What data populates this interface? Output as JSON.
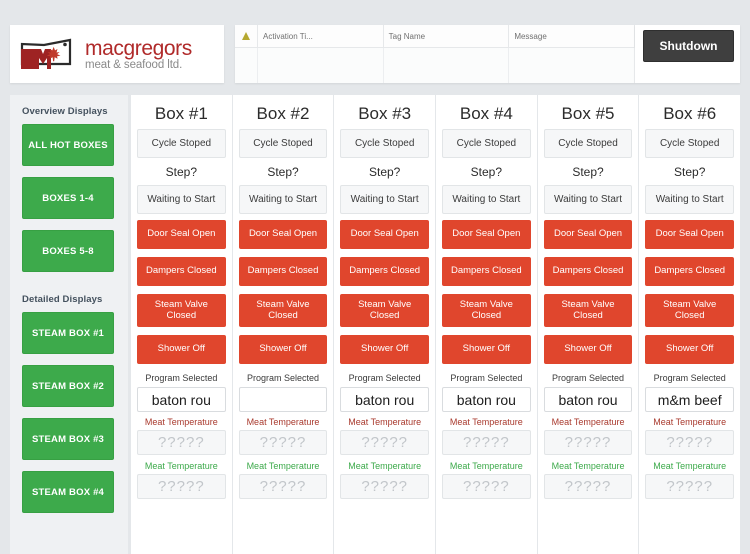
{
  "brand": {
    "name": "macgregors",
    "tagline": "meat & seafood ltd.",
    "mark_letter": "M",
    "accent_red": "#b02a2a"
  },
  "alarm_banner": {
    "warning_icon": "warning-triangle-icon",
    "columns": [
      "Activation Ti...",
      "Tag Name",
      "Message"
    ],
    "rows": []
  },
  "shutdown": {
    "label": "Shutdown",
    "color": "#3f3f3f"
  },
  "sidebar": {
    "sections": [
      {
        "heading": "Overview Displays",
        "items": [
          {
            "label": "ALL HOT BOXES",
            "name": "sidebar-item-all-hot-boxes"
          },
          {
            "label": "BOXES 1-4",
            "name": "sidebar-item-boxes-1-4"
          },
          {
            "label": "BOXES 5-8",
            "name": "sidebar-item-boxes-5-8"
          }
        ]
      },
      {
        "heading": "Detailed Displays",
        "items": [
          {
            "label": "STEAM BOX #1",
            "name": "sidebar-item-steam-box-1"
          },
          {
            "label": "STEAM BOX #2",
            "name": "sidebar-item-steam-box-2"
          },
          {
            "label": "STEAM BOX #3",
            "name": "sidebar-item-steam-box-3"
          },
          {
            "label": "STEAM BOX #4",
            "name": "sidebar-item-steam-box-4"
          }
        ]
      }
    ],
    "button_color": "#3daa4b"
  },
  "labels": {
    "step": "Step?",
    "program_selected": "Program Selected",
    "meat_temperature": "Meat Temperature",
    "temp_placeholder": "?????"
  },
  "status_colors": {
    "alarm_red": "#e0462d",
    "ok_green": "#3daa4b"
  },
  "boxes": [
    {
      "title": "Box #1",
      "cycle": "Cycle Stoped",
      "step_value": "Waiting to Start",
      "statuses": [
        "Door Seal Open",
        "Dampers Closed",
        "Steam Valve Closed",
        "Shower Off"
      ],
      "program": "baton rou",
      "temp1": "?????",
      "temp2": "?????"
    },
    {
      "title": "Box #2",
      "cycle": "Cycle Stoped",
      "step_value": "Waiting to Start",
      "statuses": [
        "Door Seal Open",
        "Dampers Closed",
        "Steam Valve Closed",
        "Shower Off"
      ],
      "program": "",
      "temp1": "?????",
      "temp2": "?????"
    },
    {
      "title": "Box #3",
      "cycle": "Cycle Stoped",
      "step_value": "Waiting to Start",
      "statuses": [
        "Door Seal Open",
        "Dampers Closed",
        "Steam Valve Closed",
        "Shower Off"
      ],
      "program": "baton rou",
      "temp1": "?????",
      "temp2": "?????"
    },
    {
      "title": "Box #4",
      "cycle": "Cycle Stoped",
      "step_value": "Waiting to Start",
      "statuses": [
        "Door Seal Open",
        "Dampers Closed",
        "Steam Valve Closed",
        "Shower Off"
      ],
      "program": "baton rou",
      "temp1": "?????",
      "temp2": "?????"
    },
    {
      "title": "Box #5",
      "cycle": "Cycle Stoped",
      "step_value": "Waiting to Start",
      "statuses": [
        "Door Seal Open",
        "Dampers Closed",
        "Steam Valve Closed",
        "Shower Off"
      ],
      "program": "baton rou",
      "temp1": "?????",
      "temp2": "?????"
    },
    {
      "title": "Box #6",
      "cycle": "Cycle Stoped",
      "step_value": "Waiting to Start",
      "statuses": [
        "Door Seal Open",
        "Dampers Closed",
        "Steam Valve Closed",
        "Shower Off"
      ],
      "program": "m&m beef",
      "temp1": "?????",
      "temp2": "?????"
    }
  ]
}
